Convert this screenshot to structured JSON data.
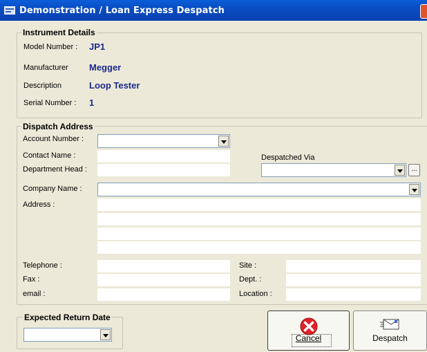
{
  "window": {
    "title": "Demonstration / Loan Express Despatch"
  },
  "instrument": {
    "legend": "Instrument Details",
    "model_label": "Model Number :",
    "model_value": "JP1",
    "manufacturer_label": "Manufacturer",
    "manufacturer_value": "Megger",
    "description_label": "Description",
    "description_value": "Loop Tester",
    "serial_label": "Serial Number :",
    "serial_value": "1"
  },
  "dispatch": {
    "legend": "Dispatch Address",
    "account_label": "Account Number :",
    "account_value": "",
    "contact_label": "Contact Name :",
    "contact_value": "",
    "dept_head_label": "Department Head :",
    "dept_head_value": "",
    "despatched_via_label": "Despatched Via",
    "despatched_via_value": "",
    "browse_label": "...",
    "company_label": "Company Name :",
    "company_value": "",
    "address_label": "Address :",
    "address_lines": [
      "",
      "",
      "",
      ""
    ],
    "telephone_label": "Telephone :",
    "telephone_value": "",
    "fax_label": "Fax :",
    "fax_value": "",
    "email_label": "email :",
    "email_value": "",
    "site_label": "Site :",
    "site_value": "",
    "dept_label": "Dept. :",
    "dept_value": "",
    "location_label": "Location :",
    "location_value": ""
  },
  "return": {
    "legend": "Expected Return Date",
    "value": ""
  },
  "buttons": {
    "cancel_label": "Cancel",
    "despatch_label": "Despatch"
  },
  "icons": {
    "window": "window-icon",
    "close": "close-icon",
    "cancel": "red-x-icon",
    "despatch": "envelope-icon"
  },
  "colors": {
    "titlebar": "#0a4cc4",
    "value_text": "#1a2a8c",
    "background": "#ece9d8"
  }
}
